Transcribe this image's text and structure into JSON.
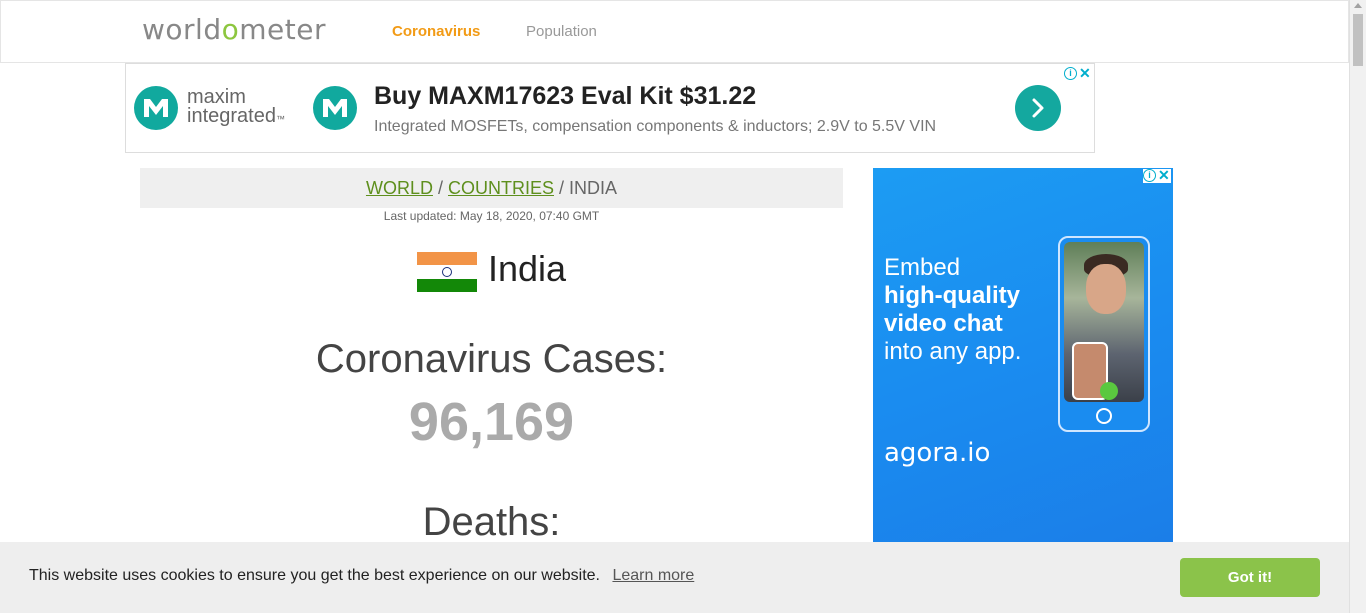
{
  "nav": {
    "logo": {
      "part1": "worldo",
      "part2": "meter",
      "o": ""
    },
    "links": [
      "Coronavirus",
      "Population"
    ]
  },
  "ad_top": {
    "brand_line1": "maxim",
    "brand_line2": "integrated",
    "brand_tm": "™",
    "headline": "Buy MAXM17623 Eval Kit $31.22",
    "description": "Integrated MOSFETs, compensation components & inductors; 2.9V to 5.5V VIN",
    "adchoice_i": "i",
    "adchoice_x": "✕"
  },
  "breadcrumb": {
    "world": "WORLD",
    "sep1": " / ",
    "countries": "COUNTRIES",
    "sep2": " / ",
    "current": "INDIA"
  },
  "last_updated": "Last updated: May 18, 2020, 07:40 GMT",
  "country": "India",
  "stats": {
    "cases_label": "Coronavirus Cases:",
    "cases_value": "96,169",
    "deaths_label": "Deaths:"
  },
  "ad_right": {
    "line1": "Embed",
    "line2": "high-quality",
    "line3": "video chat",
    "line4": "into any app.",
    "logo": "agora.io",
    "adchoice_i": "i",
    "adchoice_x": "✕"
  },
  "cookie": {
    "text": "This website uses cookies to ensure you get the best experience on our website.",
    "link": "Learn more",
    "button": "Got it!"
  },
  "colors": {
    "accent_orange": "#f29b16",
    "link_green": "#5e8f1d",
    "cookie_button": "#8bc34a",
    "ad_teal": "#11a99e",
    "ad_blue": "#1a8cf0"
  }
}
